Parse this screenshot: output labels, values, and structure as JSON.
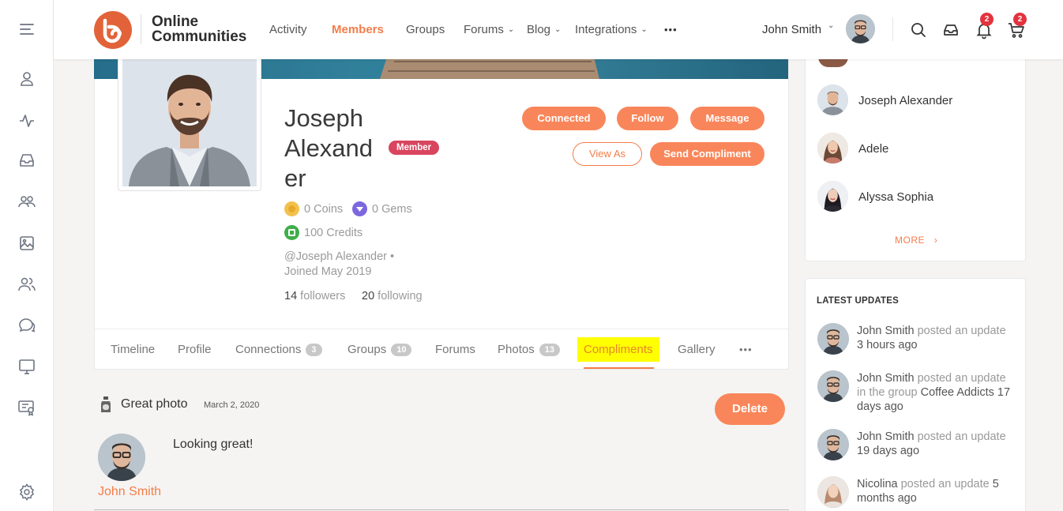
{
  "brand": {
    "line1": "Online",
    "line2": "Communities"
  },
  "nav": {
    "activity": "Activity",
    "members": "Members",
    "groups": "Groups",
    "forums": "Forums",
    "blog": "Blog",
    "integrations": "Integrations",
    "more": "•••"
  },
  "user": {
    "name": "John Smith"
  },
  "header_badges": {
    "notifications": "2",
    "cart": "2"
  },
  "profile": {
    "name_line1": "Joseph",
    "name_line2": "Alexand",
    "name_line3": "er",
    "role_badge": "Member",
    "coins": "0 Coins",
    "gems": "0 Gems",
    "credits": "100 Credits",
    "handle": "@Joseph Alexander •",
    "joined": "Joined May 2019",
    "followers_count": "14",
    "followers_label": "followers",
    "following_count": "20",
    "following_label": "following"
  },
  "actions": {
    "connected": "Connected",
    "follow": "Follow",
    "message": "Message",
    "view_as": "View As",
    "send_compliment": "Send Compliment"
  },
  "tabs": {
    "timeline": "Timeline",
    "profile": "Profile",
    "connections": "Connections",
    "connections_count": "3",
    "groups": "Groups",
    "groups_count": "10",
    "forums": "Forums",
    "photos": "Photos",
    "photos_count": "13",
    "compliments": "Compliments",
    "gallery": "Gallery",
    "more": "•••"
  },
  "compliment": {
    "title": "Great photo",
    "date": "March 2, 2020",
    "delete": "Delete",
    "message": "Looking great!",
    "author": "John Smith"
  },
  "members_widget": {
    "items": [
      "Joseph Alexander",
      "Adele",
      "Alyssa Sophia"
    ],
    "more": "MORE"
  },
  "updates": {
    "title": "LATEST UPDATES",
    "items": [
      {
        "name": "John Smith",
        "action": " posted an update",
        "time": "3 hours ago"
      },
      {
        "name": "John Smith",
        "action": " posted an update in the group ",
        "group": "Coffee Addicts",
        "time": " 17 days ago"
      },
      {
        "name": "John Smith",
        "action": " posted an update",
        "time": "19 days ago"
      },
      {
        "name": "Nicolina",
        "action": " posted an update ",
        "time": "5 months ago"
      }
    ]
  },
  "colors": {
    "accent": "#f9865a",
    "member_badge": "#d9455f",
    "highlight": "#ffff00"
  }
}
